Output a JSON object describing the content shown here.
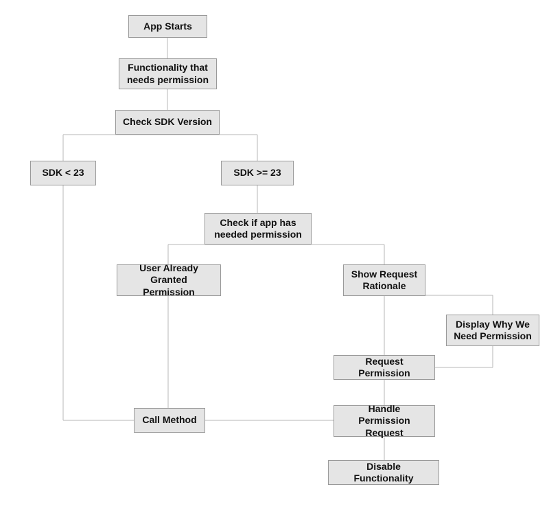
{
  "nodes": {
    "app_starts": "App Starts",
    "functionality_needs": "Functionality that needs permission",
    "check_sdk": "Check SDK Version",
    "sdk_lt": "SDK < 23",
    "sdk_gte": "SDK >= 23",
    "check_app_has": "Check if app has needed permission",
    "user_already": "User Already Granted Permission",
    "show_rationale": "Show Request Rationale",
    "display_why": "Display Why We Need Permission",
    "request_permission": "Request Permission",
    "call_method": "Call Method",
    "handle_request": "Handle Permission Request",
    "disable_func": "Disable Functionality"
  }
}
